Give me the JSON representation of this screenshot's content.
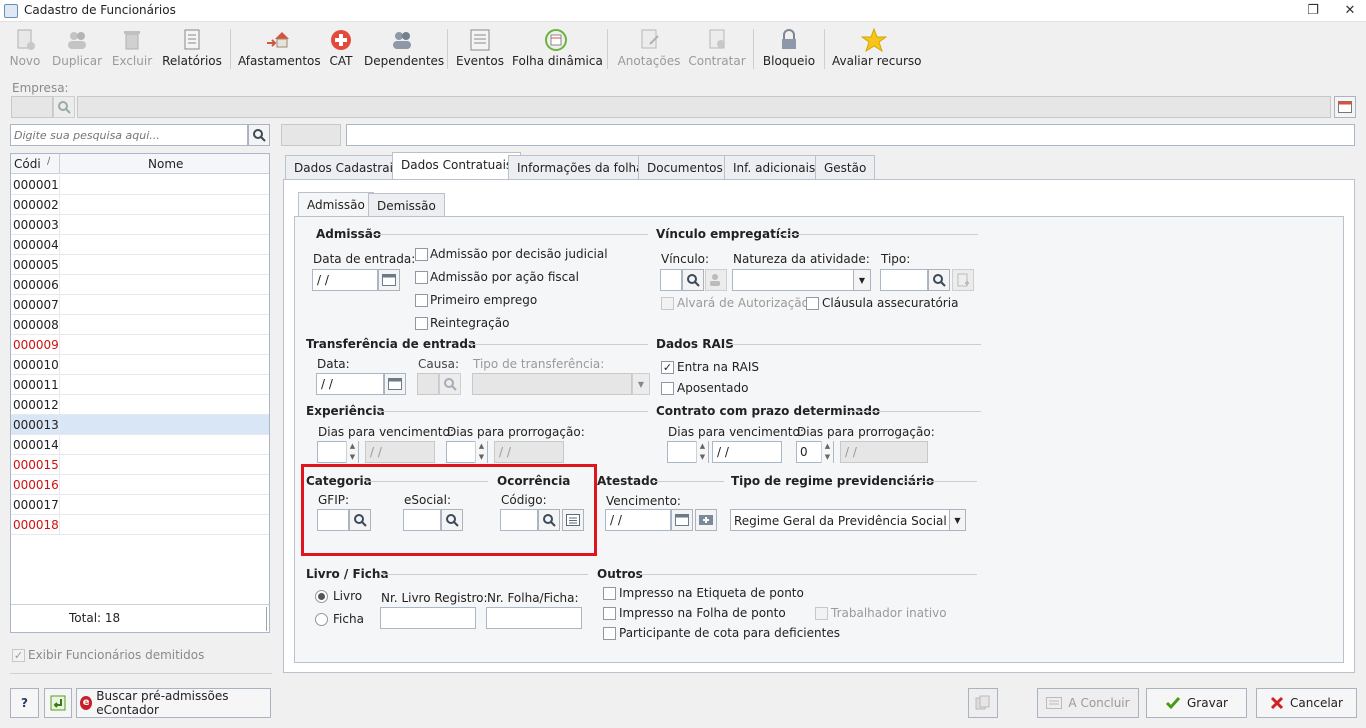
{
  "window": {
    "title": "Cadastro de Funcionários"
  },
  "toolbar": {
    "novo": "Novo",
    "duplicar": "Duplicar",
    "excluir": "Excluir",
    "relatorios": "Relatórios",
    "afastamentos": "Afastamentos",
    "cat": "CAT",
    "dependentes": "Dependentes",
    "eventos": "Eventos",
    "folha_dinamica": "Folha dinâmica",
    "anotacoes": "Anotações",
    "contratar": "Contratar",
    "bloqueio": "Bloqueio",
    "avaliar": "Avaliar recurso"
  },
  "empresa": {
    "label": "Empresa:"
  },
  "search": {
    "placeholder": "Digite sua pesquisa aqui..."
  },
  "grid": {
    "col_code": "Códi",
    "col_name": "Nome",
    "rows": [
      {
        "code": "000001",
        "red": false
      },
      {
        "code": "000002",
        "red": false
      },
      {
        "code": "000003",
        "red": false
      },
      {
        "code": "000004",
        "red": false
      },
      {
        "code": "000005",
        "red": false
      },
      {
        "code": "000006",
        "red": false
      },
      {
        "code": "000007",
        "red": false
      },
      {
        "code": "000008",
        "red": false
      },
      {
        "code": "000009",
        "red": true
      },
      {
        "code": "000010",
        "red": false
      },
      {
        "code": "000011",
        "red": false
      },
      {
        "code": "000012",
        "red": false
      },
      {
        "code": "000013",
        "red": false
      },
      {
        "code": "000014",
        "red": false
      },
      {
        "code": "000015",
        "red": true
      },
      {
        "code": "000016",
        "red": true
      },
      {
        "code": "000017",
        "red": false
      },
      {
        "code": "000018",
        "red": true
      }
    ],
    "total": "Total: 18"
  },
  "show_dismissed": "Exibir Funcionários demitidos",
  "tabs": [
    "Dados Cadastrais",
    "Dados Contratuais",
    "Informações da folha",
    "Documentos",
    "Inf. adicionais",
    "Gestão"
  ],
  "subtabs": [
    "Admissão",
    "Demissão"
  ],
  "admissao": {
    "title": "Admissão",
    "data_entrada": "Data de entrada:",
    "date_value": " / /",
    "chk1": "Admissão por decisão judicial",
    "chk2": "Admissão por ação fiscal",
    "chk3": "Primeiro emprego",
    "chk4": "Reintegração"
  },
  "vinculo": {
    "title": "Vínculo empregatício",
    "vinculo": "Vínculo:",
    "natureza": "Natureza da atividade:",
    "tipo": "Tipo:",
    "alvara": "Alvará de Autorização",
    "clausula": "Cláusula assecuratória"
  },
  "transferencia": {
    "title": "Transferência de entrada",
    "data": "Data:",
    "causa": "Causa:",
    "tipo": "Tipo de transferência:",
    "date_value": " / /"
  },
  "rais": {
    "title": "Dados RAIS",
    "entra": "Entra na RAIS",
    "aposentado": "Aposentado",
    "check": "✓"
  },
  "experiencia": {
    "title": "Experiência",
    "venc": "Dias para vencimento:",
    "prorrog": "Dias para prorrogação:",
    "date_value": " / /"
  },
  "contrato": {
    "title": "Contrato com prazo determinado",
    "venc": "Dias para vencimento:",
    "prorrog": "Dias para prorrogação:",
    "date_value": " / /",
    "dias_value": "0"
  },
  "categoria": {
    "title": "Categoria",
    "gfip": "GFIP:",
    "esocial": "eSocial:"
  },
  "ocorrencia": {
    "title": "Ocorrência",
    "codigo": "Código:"
  },
  "atestado": {
    "title": "Atestado",
    "venc": "Vencimento:",
    "date_value": " / /"
  },
  "regime": {
    "title": "Tipo de regime previdenciário",
    "value": "Regime Geral da Previdência Social (RGP"
  },
  "livro": {
    "title": "Livro / Ficha",
    "livro": "Livro",
    "ficha": "Ficha",
    "nr_livro": "Nr. Livro Registro:",
    "nr_folha": "Nr. Folha/Ficha:"
  },
  "outros": {
    "title": "Outros",
    "c1": "Impresso na Etiqueta de ponto",
    "c2": "Impresso na Folha de ponto",
    "c3": "Trabalhador inativo",
    "c4": "Participante de cota para deficientes"
  },
  "bottom": {
    "help": "?",
    "buscar": "Buscar pré-admissões eContador",
    "concluir": "A Concluir",
    "gravar": "Gravar",
    "cancelar": "Cancelar"
  }
}
